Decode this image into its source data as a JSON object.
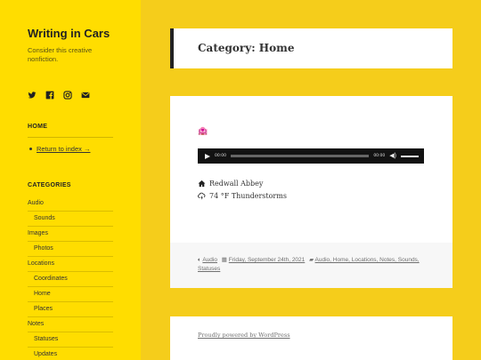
{
  "site": {
    "title": "Writing in Cars",
    "description": "Consider this creative nonfiction."
  },
  "social": [
    {
      "icon": "twitter-icon"
    },
    {
      "icon": "facebook-icon"
    },
    {
      "icon": "instagram-icon"
    },
    {
      "icon": "email-icon"
    }
  ],
  "home_widget": {
    "title": "HOME",
    "link_label": "Return to index →"
  },
  "categories_widget": {
    "title": "CATEGORIES",
    "items": [
      {
        "label": "Audio",
        "level": 0
      },
      {
        "label": "Sounds",
        "level": 1
      },
      {
        "label": "Images",
        "level": 0
      },
      {
        "label": "Photos",
        "level": 1
      },
      {
        "label": "Locations",
        "level": 0
      },
      {
        "label": "Coordinates",
        "level": 1
      },
      {
        "label": "Home",
        "level": 1
      },
      {
        "label": "Places",
        "level": 1
      },
      {
        "label": "Notes",
        "level": 0
      },
      {
        "label": "Statuses",
        "level": 1
      },
      {
        "label": "Updates",
        "level": 1
      }
    ]
  },
  "header": {
    "title": "Category: Home"
  },
  "post": {
    "emoji": "🏩",
    "audio": {
      "current_time": "00:00",
      "duration": "00:00"
    },
    "location": "Redwall Abbey",
    "weather": "74 °F Thunderstorms",
    "footer": {
      "format": "Audio",
      "date": "Friday, September 24th, 2021",
      "categories": "Audio, Home, Locations, Notes, Sounds, Statuses"
    }
  },
  "footer": {
    "powered": "Proudly powered by WordPress"
  }
}
